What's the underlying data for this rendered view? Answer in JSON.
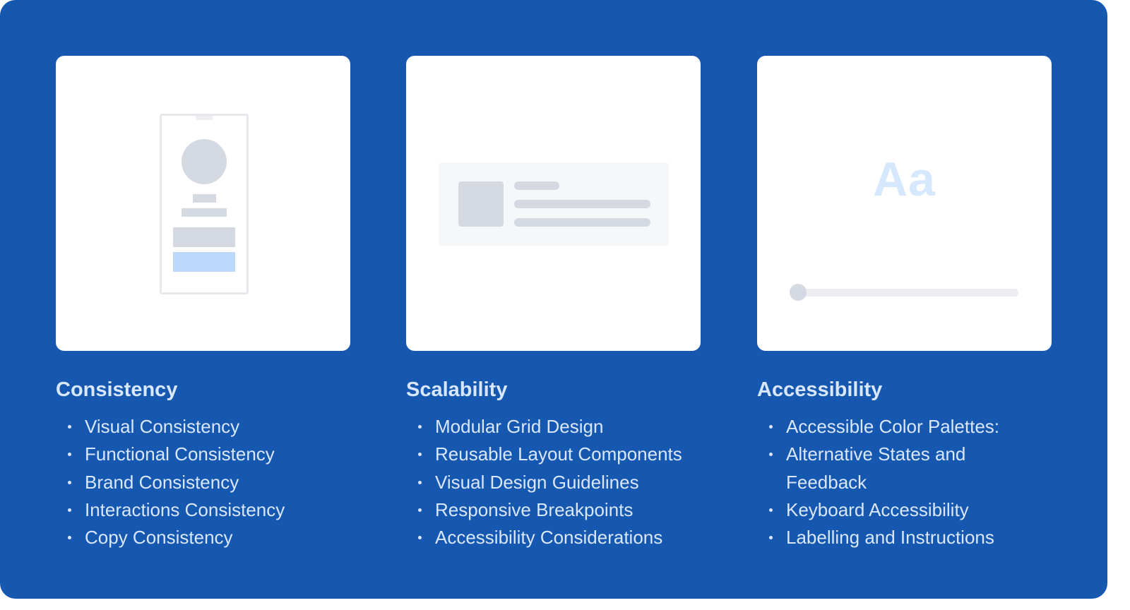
{
  "colors": {
    "background": "#1657b0",
    "card": "#ffffff",
    "text": "#d8e7fb",
    "placeholder_gray": "#d5dae2",
    "accent_light_blue": "#bcd8fb"
  },
  "columns": [
    {
      "title": "Consistency",
      "illustration": "phone-profile-wireframe",
      "items": [
        "Visual Consistency",
        "Functional Consistency",
        "Brand Consistency",
        "Interactions Consistency",
        "Copy Consistency"
      ]
    },
    {
      "title": "Scalability",
      "illustration": "list-tile-wireframe",
      "items": [
        "Modular Grid Design",
        "Reusable Layout Components",
        "Visual Design Guidelines",
        "Responsive Breakpoints",
        "Accessibility Considerations"
      ]
    },
    {
      "title": "Accessibility",
      "illustration": "type-scale-slider",
      "type_sample": "Aa",
      "slider_value_percent": 0,
      "items": [
        "Accessible Color Palettes:",
        "Alternative States and Feedback",
        "Keyboard Accessibility",
        "Labelling and Instructions"
      ]
    }
  ]
}
